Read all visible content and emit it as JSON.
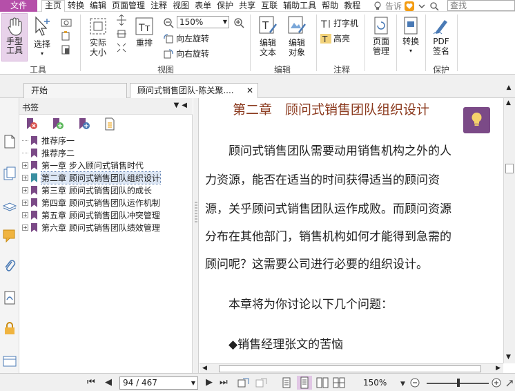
{
  "menubar": {
    "file": "文件",
    "items": [
      "主页",
      "转换",
      "编辑",
      "页面管理",
      "注释",
      "视图",
      "表单",
      "保护",
      "共享",
      "互联",
      "辅助工具",
      "帮助",
      "教程"
    ],
    "tell_me": "告诉",
    "search_placeholder": "查找"
  },
  "ribbon": {
    "hand_tool": "手型\n工具",
    "select": "选择",
    "actual_size": "实际\n大小",
    "reflow": "重排",
    "zoom_value": "150%",
    "rotate_left": "向左旋转",
    "rotate_right": "向右旋转",
    "edit_text": "编辑\n文本",
    "edit_object": "编辑\n对象",
    "typewriter": "打字机",
    "highlight": "高亮",
    "page_manage": "页面\n管理",
    "convert": "转换",
    "pdf_sign": "PDF\n签名",
    "groups": {
      "tools": "工具",
      "view": "视图",
      "edit": "编辑",
      "annotate": "注释",
      "protect": "保护"
    }
  },
  "tabs": [
    {
      "label": "开始"
    },
    {
      "label": "顾问式销售团队-陈关聚...."
    }
  ],
  "bookmarks": {
    "title": "书签",
    "items": [
      {
        "label": "推荐序一",
        "expandable": false,
        "selected": false
      },
      {
        "label": "推荐序二",
        "expandable": false,
        "selected": false
      },
      {
        "label": "第一章 步入顾问式销售时代",
        "expandable": true,
        "selected": false
      },
      {
        "label": "第二章 顾问式销售团队组织设计",
        "expandable": true,
        "selected": true
      },
      {
        "label": "第三章 顾问式销售团队的成长",
        "expandable": true,
        "selected": false
      },
      {
        "label": "第四章 顾问式销售团队运作机制",
        "expandable": true,
        "selected": false
      },
      {
        "label": "第五章 顾问式销售团队冲突管理",
        "expandable": true,
        "selected": false
      },
      {
        "label": "第六章 顾问式销售团队绩效管理",
        "expandable": true,
        "selected": false
      }
    ]
  },
  "document": {
    "chapter_title": "第二章　顾问式销售团队组织设计",
    "lines": [
      "　　顾问式销售团队需要动用销售机构之外的人",
      "力资源，能否在适当的时间获得适当的顾问资",
      "源，关乎顾问式销售团队运作成败。而顾问资源",
      "分布在其他部门，销售机构如何才能得到急需的",
      "顾问呢？这需要公司进行必要的组织设计。",
      "　　本章将为你讨论以下几个问题：",
      "　　◆销售经理张文的苦恼"
    ]
  },
  "status": {
    "page": "94 / 467",
    "zoom": "150%"
  },
  "colors": {
    "accent": "#b54fa9",
    "chapter_title": "#8b3a1e",
    "tip_button": "#7b4a87"
  }
}
